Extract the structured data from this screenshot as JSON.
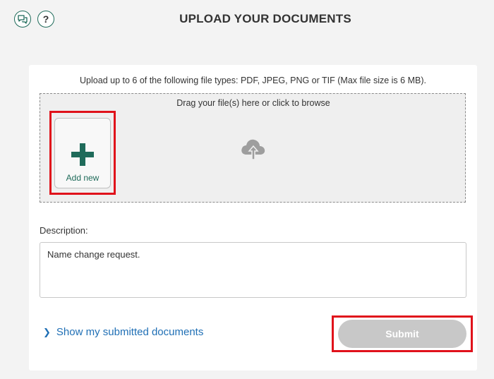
{
  "header": {
    "title": "UPLOAD YOUR DOCUMENTS",
    "feedback_icon": "feedback-chat-icon",
    "help_label": "?"
  },
  "upload": {
    "instructions": "Upload up to 6 of the following file types: PDF, JPEG, PNG or TIF (Max file size is 6 MB).",
    "dropzone_hint": "Drag your file(s) here or click to browse",
    "add_new_label": "Add new",
    "cloud_icon": "cloud-upload-icon"
  },
  "description": {
    "label": "Description:",
    "value": "Name change request."
  },
  "footer": {
    "submitted_link": "Show my submitted documents",
    "submit_label": "Submit"
  },
  "colors": {
    "accent_green": "#1f6b5a",
    "link_blue": "#1f6fb5",
    "highlight_red": "#e0121b",
    "disabled_gray": "#c8c8c8"
  }
}
